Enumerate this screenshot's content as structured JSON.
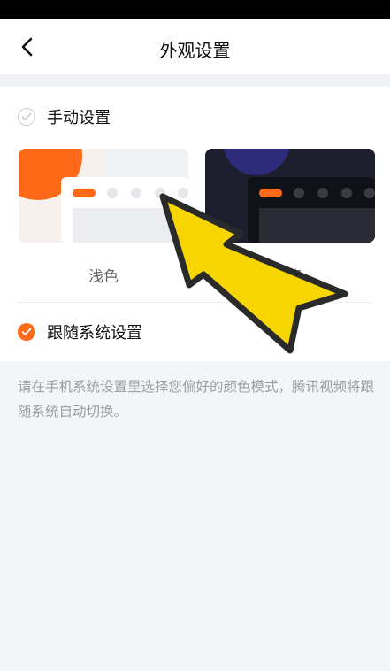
{
  "header": {
    "title": "外观设置",
    "back_icon": "chevron-left-icon"
  },
  "manual": {
    "label": "手动设置",
    "options": [
      {
        "label": "浅色",
        "theme": "light"
      },
      {
        "label": "深色",
        "theme": "dark"
      }
    ]
  },
  "system": {
    "label": "跟随系统设置",
    "selected": true
  },
  "description": "请在手机系统设置里选择您偏好的颜色模式，腾讯视频将跟随系统自动切换。",
  "colors": {
    "accent": "#ff6a1a",
    "dark_thumb_bg": "#1e1f2e",
    "annotation_arrow": "#f7d500"
  }
}
